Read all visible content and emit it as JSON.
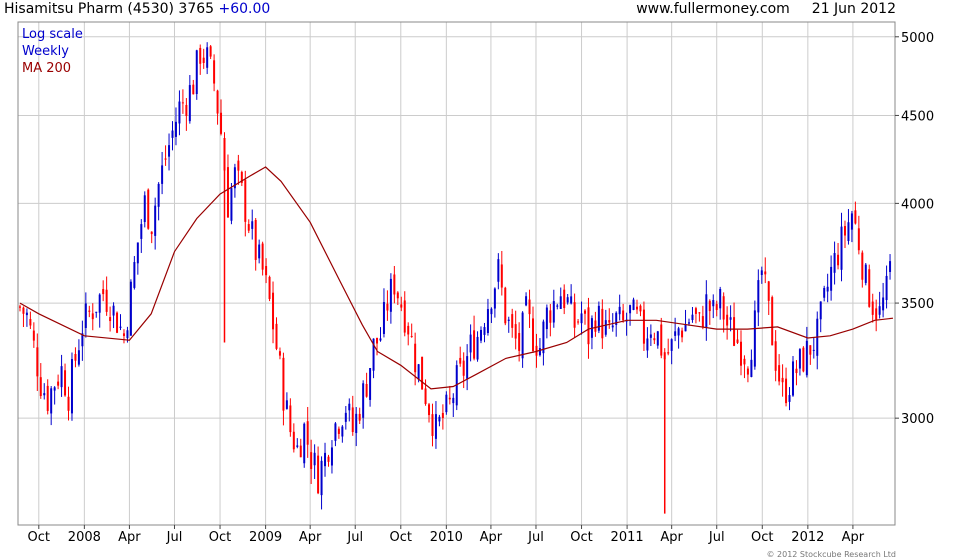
{
  "header": {
    "ticker_text": "Hisamitsu Pharm (4530) 3765",
    "change": "+60.00",
    "source": "www.fullermoney.com",
    "date": "21 Jun 2012"
  },
  "legend": {
    "scale": "Log scale",
    "period": "Weekly",
    "ma": "MA 200"
  },
  "footer": "© 2012 Stockcube Research Ltd",
  "colors": {
    "up": "#0000cc",
    "down": "#ff0000",
    "ma": "#990000",
    "grid": "#cccccc",
    "legend_blue": "#0000cc",
    "legend_ma": "#990000",
    "change": "#0000cc"
  },
  "chart_data": {
    "type": "candlestick",
    "scale": "log",
    "period": "weekly",
    "ylim": [
      2600,
      5100
    ],
    "yticks": [
      3000,
      3500,
      4000,
      4500,
      5000
    ],
    "x_range": [
      "2007-08-20",
      "2012-06-25"
    ],
    "x_ticks": [
      {
        "label": "Oct",
        "date": "2007-10-01"
      },
      {
        "label": "2008",
        "date": "2008-01-01"
      },
      {
        "label": "Apr",
        "date": "2008-04-01"
      },
      {
        "label": "Jul",
        "date": "2008-07-01"
      },
      {
        "label": "Oct",
        "date": "2008-10-01"
      },
      {
        "label": "2009",
        "date": "2009-01-01"
      },
      {
        "label": "Apr",
        "date": "2009-04-01"
      },
      {
        "label": "Jul",
        "date": "2009-07-01"
      },
      {
        "label": "Oct",
        "date": "2009-10-01"
      },
      {
        "label": "2010",
        "date": "2010-01-01"
      },
      {
        "label": "Apr",
        "date": "2010-04-01"
      },
      {
        "label": "Jul",
        "date": "2010-07-01"
      },
      {
        "label": "Oct",
        "date": "2010-10-01"
      },
      {
        "label": "2011",
        "date": "2011-01-01"
      },
      {
        "label": "Apr",
        "date": "2011-04-01"
      },
      {
        "label": "Jul",
        "date": "2011-07-01"
      },
      {
        "label": "Oct",
        "date": "2011-10-01"
      },
      {
        "label": "2012",
        "date": "2012-01-01"
      },
      {
        "label": "Apr",
        "date": "2012-04-01"
      }
    ],
    "price_path": [
      [
        "2007-08-24",
        3480
      ],
      [
        "2007-09-07",
        3440
      ],
      [
        "2007-09-21",
        3300
      ],
      [
        "2007-10-05",
        3150
      ],
      [
        "2007-10-19",
        3080
      ],
      [
        "2007-11-02",
        3150
      ],
      [
        "2007-11-16",
        3200
      ],
      [
        "2007-11-30",
        3100
      ],
      [
        "2007-12-14",
        3250
      ],
      [
        "2007-12-28",
        3400
      ],
      [
        "2008-01-11",
        3450
      ],
      [
        "2008-01-25",
        3500
      ],
      [
        "2008-02-08",
        3550
      ],
      [
        "2008-02-22",
        3500
      ],
      [
        "2008-03-07",
        3420
      ],
      [
        "2008-03-21",
        3350
      ],
      [
        "2008-04-04",
        3550
      ],
      [
        "2008-04-18",
        3800
      ],
      [
        "2008-05-02",
        4000
      ],
      [
        "2008-05-16",
        3900
      ],
      [
        "2008-05-30",
        4100
      ],
      [
        "2008-06-13",
        4250
      ],
      [
        "2008-06-27",
        4400
      ],
      [
        "2008-07-11",
        4550
      ],
      [
        "2008-07-25",
        4600
      ],
      [
        "2008-08-08",
        4700
      ],
      [
        "2008-08-22",
        4900
      ],
      [
        "2008-09-05",
        4850
      ],
      [
        "2008-09-19",
        4700
      ],
      [
        "2008-10-03",
        4400
      ],
      [
        "2008-10-17",
        4000
      ],
      [
        "2008-10-31",
        4150
      ],
      [
        "2008-11-14",
        4050
      ],
      [
        "2008-11-28",
        3900
      ],
      [
        "2008-12-12",
        3750
      ],
      [
        "2008-12-26",
        3650
      ],
      [
        "2009-01-09",
        3500
      ],
      [
        "2009-01-23",
        3300
      ],
      [
        "2009-02-06",
        3100
      ],
      [
        "2009-02-20",
        2950
      ],
      [
        "2009-03-06",
        2880
      ],
      [
        "2009-03-20",
        2960
      ],
      [
        "2009-04-03",
        2850
      ],
      [
        "2009-04-17",
        2780
      ],
      [
        "2009-05-01",
        2850
      ],
      [
        "2009-05-15",
        2950
      ],
      [
        "2009-05-29",
        3000
      ],
      [
        "2009-06-12",
        3050
      ],
      [
        "2009-06-26",
        2950
      ],
      [
        "2009-07-10",
        3050
      ],
      [
        "2009-07-24",
        3150
      ],
      [
        "2009-08-07",
        3300
      ],
      [
        "2009-08-21",
        3350
      ],
      [
        "2009-09-04",
        3500
      ],
      [
        "2009-09-18",
        3600
      ],
      [
        "2009-10-02",
        3500
      ],
      [
        "2009-10-16",
        3400
      ],
      [
        "2009-10-30",
        3250
      ],
      [
        "2009-11-13",
        3150
      ],
      [
        "2009-11-27",
        3050
      ],
      [
        "2009-12-11",
        2950
      ],
      [
        "2009-12-25",
        3000
      ],
      [
        "2010-01-08",
        3050
      ],
      [
        "2010-01-22",
        3150
      ],
      [
        "2010-02-05",
        3200
      ],
      [
        "2010-02-19",
        3300
      ],
      [
        "2010-03-05",
        3350
      ],
      [
        "2010-03-19",
        3450
      ],
      [
        "2010-04-02",
        3550
      ],
      [
        "2010-04-16",
        3650
      ],
      [
        "2010-04-30",
        3450
      ],
      [
        "2010-05-14",
        3350
      ],
      [
        "2010-05-28",
        3300
      ],
      [
        "2010-06-11",
        3450
      ],
      [
        "2010-06-25",
        3350
      ],
      [
        "2010-07-09",
        3300
      ],
      [
        "2010-07-23",
        3450
      ],
      [
        "2010-08-06",
        3500
      ],
      [
        "2010-08-20",
        3550
      ],
      [
        "2010-09-03",
        3500
      ],
      [
        "2010-09-17",
        3400
      ],
      [
        "2010-10-01",
        3450
      ],
      [
        "2010-10-15",
        3350
      ],
      [
        "2010-10-29",
        3450
      ],
      [
        "2010-11-12",
        3400
      ],
      [
        "2010-11-26",
        3350
      ],
      [
        "2010-12-10",
        3420
      ],
      [
        "2010-12-24",
        3400
      ],
      [
        "2011-01-07",
        3450
      ],
      [
        "2011-01-21",
        3420
      ],
      [
        "2011-02-04",
        3350
      ],
      [
        "2011-02-18",
        3400
      ],
      [
        "2011-03-04",
        3350
      ],
      [
        "2011-03-18",
        3250
      ],
      [
        "2011-04-01",
        3300
      ],
      [
        "2011-04-15",
        3380
      ],
      [
        "2011-04-29",
        3400
      ],
      [
        "2011-05-13",
        3450
      ],
      [
        "2011-05-27",
        3400
      ],
      [
        "2011-06-10",
        3500
      ],
      [
        "2011-06-24",
        3450
      ],
      [
        "2011-07-08",
        3500
      ],
      [
        "2011-07-22",
        3400
      ],
      [
        "2011-08-05",
        3350
      ],
      [
        "2011-08-19",
        3300
      ],
      [
        "2011-09-02",
        3250
      ],
      [
        "2011-09-16",
        3400
      ],
      [
        "2011-09-30",
        3650
      ],
      [
        "2011-10-14",
        3450
      ],
      [
        "2011-10-28",
        3250
      ],
      [
        "2011-11-11",
        3100
      ],
      [
        "2011-11-25",
        3150
      ],
      [
        "2011-12-09",
        3200
      ],
      [
        "2011-12-23",
        3250
      ],
      [
        "2012-01-06",
        3300
      ],
      [
        "2012-01-20",
        3350
      ],
      [
        "2012-02-03",
        3500
      ],
      [
        "2012-02-17",
        3650
      ],
      [
        "2012-03-02",
        3750
      ],
      [
        "2012-03-16",
        3850
      ],
      [
        "2012-03-30",
        3950
      ],
      [
        "2012-04-13",
        3800
      ],
      [
        "2012-04-27",
        3600
      ],
      [
        "2012-05-11",
        3500
      ],
      [
        "2012-05-25",
        3450
      ],
      [
        "2012-06-08",
        3550
      ],
      [
        "2012-06-21",
        3765
      ]
    ],
    "spikes": [
      {
        "date": "2008-10-10",
        "low": 3320
      },
      {
        "date": "2011-03-18",
        "low": 2640
      }
    ],
    "ma_200": [
      [
        "2007-08-24",
        3500
      ],
      [
        "2007-10-01",
        3450
      ],
      [
        "2008-01-01",
        3350
      ],
      [
        "2008-04-01",
        3330
      ],
      [
        "2008-05-15",
        3450
      ],
      [
        "2008-07-01",
        3750
      ],
      [
        "2008-08-15",
        3920
      ],
      [
        "2008-10-01",
        4050
      ],
      [
        "2008-12-01",
        4150
      ],
      [
        "2009-01-01",
        4200
      ],
      [
        "2009-02-01",
        4120
      ],
      [
        "2009-04-01",
        3900
      ],
      [
        "2009-06-01",
        3600
      ],
      [
        "2009-07-15",
        3400
      ],
      [
        "2009-08-15",
        3280
      ],
      [
        "2009-10-01",
        3220
      ],
      [
        "2009-12-01",
        3120
      ],
      [
        "2010-01-15",
        3130
      ],
      [
        "2010-03-01",
        3180
      ],
      [
        "2010-05-01",
        3250
      ],
      [
        "2010-07-01",
        3280
      ],
      [
        "2010-09-01",
        3320
      ],
      [
        "2010-10-15",
        3380
      ],
      [
        "2011-01-01",
        3420
      ],
      [
        "2011-03-01",
        3420
      ],
      [
        "2011-05-01",
        3400
      ],
      [
        "2011-07-01",
        3380
      ],
      [
        "2011-09-01",
        3380
      ],
      [
        "2011-11-01",
        3390
      ],
      [
        "2012-01-01",
        3340
      ],
      [
        "2012-02-15",
        3350
      ],
      [
        "2012-04-01",
        3380
      ],
      [
        "2012-05-15",
        3420
      ],
      [
        "2012-06-21",
        3430
      ]
    ]
  }
}
